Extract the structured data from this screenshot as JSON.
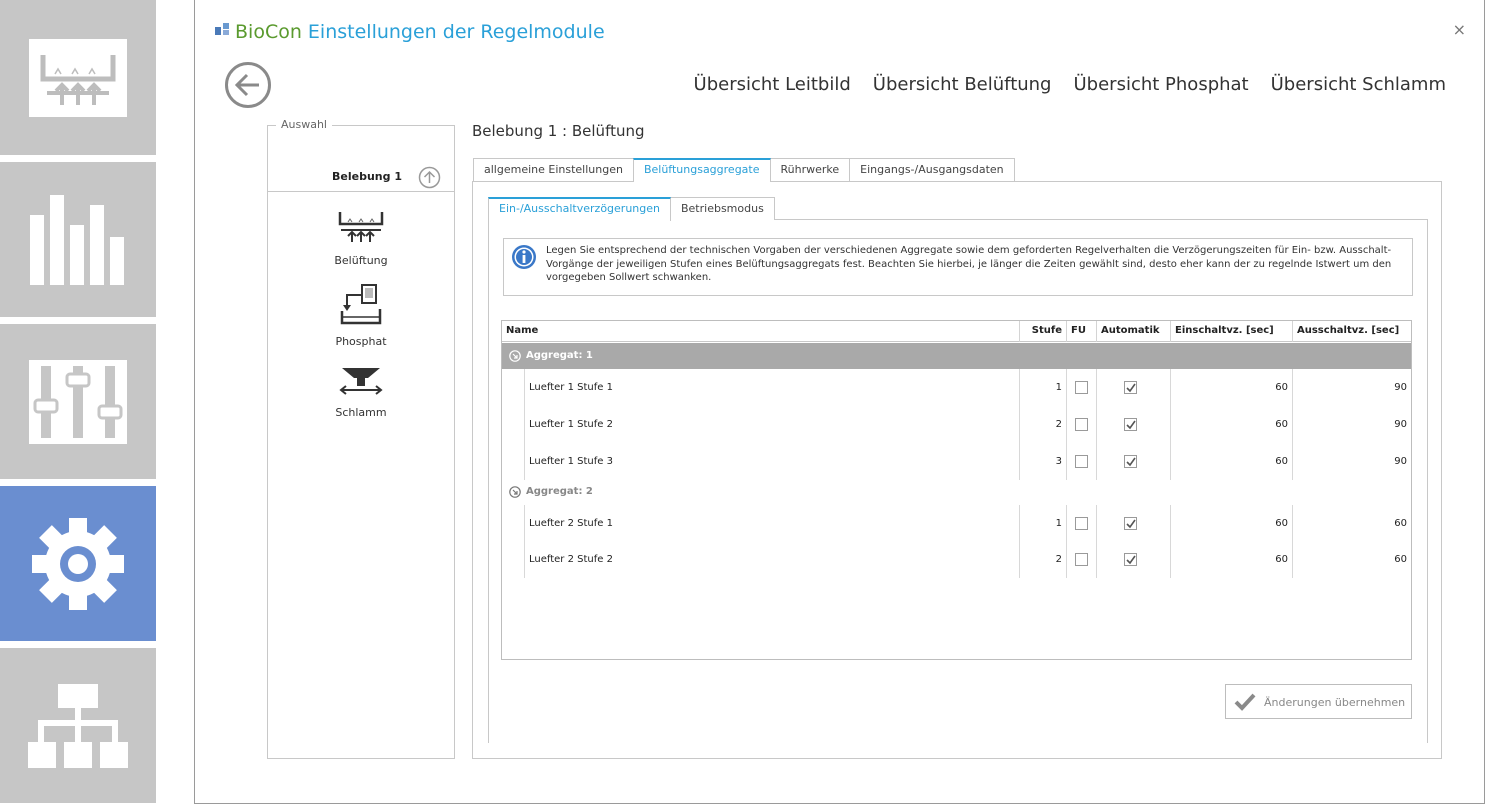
{
  "window": {
    "title_brand": "BioCon",
    "title_rest": "Einstellungen der Regelmodule",
    "close_label": "×"
  },
  "rail": {
    "items": [
      {
        "icon": "aeration-basin-icon",
        "active": false
      },
      {
        "icon": "bar-chart-icon",
        "active": false
      },
      {
        "icon": "sliders-icon",
        "active": false
      },
      {
        "icon": "gear-icon",
        "active": true
      },
      {
        "icon": "hierarchy-icon",
        "active": false
      }
    ],
    "active_color": "#6a8ed0",
    "tile_color": "#c6c6c6"
  },
  "topnav": [
    "Übersicht Leitbild",
    "Übersicht Belüftung",
    "Übersicht Phosphat",
    "Übersicht Schlamm"
  ],
  "auswahl": {
    "legend": "Auswahl",
    "current": "Belebung 1",
    "items": [
      {
        "label": "Belüftung",
        "icon": "aeration-icon"
      },
      {
        "label": "Phosphat",
        "icon": "phosphate-dosing-icon"
      },
      {
        "label": "Schlamm",
        "icon": "sludge-icon"
      }
    ]
  },
  "section_title": "Belebung 1 : Belüftung",
  "tabs": [
    "allgemeine Einstellungen",
    "Belüftungsaggregate",
    "Rührwerke",
    "Eingangs-/Ausgangsdaten"
  ],
  "active_tab": "Belüftungsaggregate",
  "subtabs": [
    "Ein-/Ausschaltverzögerungen",
    "Betriebsmodus"
  ],
  "active_subtab": "Ein-/Ausschaltverzögerungen",
  "info": {
    "text": "Legen Sie entsprechend der technischen Vorgaben der verschiedenen Aggregate sowie dem geforderten Regelverhalten die Verzögerungszeiten für Ein- bzw. Ausschalt-Vorgänge der jeweiligen Stufen eines Belüftungsaggregats fest. Beachten Sie hierbei, je länger die Zeiten gewählt sind, desto eher kann der zu regelnde Istwert um den vorgegeben Sollwert schwanken."
  },
  "grid": {
    "columns": [
      "Name",
      "Stufe",
      "FU",
      "Automatik",
      "Einschaltvz. [sec]",
      "Ausschaltvz. [sec]"
    ],
    "groups": [
      {
        "label": "Aggregat: 1",
        "selected": true,
        "rows": [
          {
            "name": "Luefter 1 Stufe 1",
            "stufe": "1",
            "fu": false,
            "automatik": true,
            "ein": "60",
            "aus": "90"
          },
          {
            "name": "Luefter 1 Stufe 2",
            "stufe": "2",
            "fu": false,
            "automatik": true,
            "ein": "60",
            "aus": "90"
          },
          {
            "name": "Luefter 1 Stufe 3",
            "stufe": "3",
            "fu": false,
            "automatik": true,
            "ein": "60",
            "aus": "90"
          }
        ]
      },
      {
        "label": "Aggregat: 2",
        "selected": false,
        "rows": [
          {
            "name": "Luefter 2 Stufe 1",
            "stufe": "1",
            "fu": false,
            "automatik": true,
            "ein": "60",
            "aus": "60"
          },
          {
            "name": "Luefter 2 Stufe 2",
            "stufe": "2",
            "fu": false,
            "automatik": true,
            "ein": "60",
            "aus": "60"
          }
        ]
      }
    ]
  },
  "apply_button": {
    "label": "Änderungen übernehmen",
    "enabled": false
  }
}
